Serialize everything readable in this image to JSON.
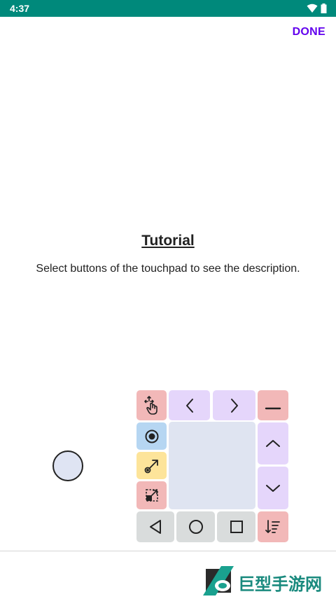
{
  "status_bar": {
    "time": "4:37"
  },
  "header": {
    "done_label": "DONE"
  },
  "tutorial": {
    "title": "Tutorial",
    "description": "Select buttons of the touchpad to see the description."
  },
  "touchpad": {
    "buttons": [
      {
        "name": "move-button",
        "icon": "move-hand-icon",
        "color": "#f2b8b8"
      },
      {
        "name": "left-arrow-button",
        "icon": "chevron-left-icon",
        "color": "#e5d6fb"
      },
      {
        "name": "right-arrow-button",
        "icon": "chevron-right-icon",
        "color": "#e5d6fb"
      },
      {
        "name": "minimize-button",
        "icon": "minus-icon",
        "color": "#f2b8b8"
      },
      {
        "name": "click-button",
        "icon": "radio-dot-icon",
        "color": "#b6d6f2"
      },
      {
        "name": "up-button",
        "icon": "chevron-up-icon",
        "color": "#e5d6fb"
      },
      {
        "name": "drag-button",
        "icon": "drag-arrow-icon",
        "color": "#fde49a"
      },
      {
        "name": "down-button",
        "icon": "chevron-down-icon",
        "color": "#e5d6fb"
      },
      {
        "name": "resize-button",
        "icon": "resize-icon",
        "color": "#f2b8b8"
      },
      {
        "name": "back-button",
        "icon": "triangle-back-icon",
        "color": "#d9dcdc"
      },
      {
        "name": "home-button",
        "icon": "circle-home-icon",
        "color": "#d9dcdc"
      },
      {
        "name": "recents-button",
        "icon": "square-recents-icon",
        "color": "#d9dcdc"
      },
      {
        "name": "sort-button",
        "icon": "sort-down-icon",
        "color": "#f2b8b8"
      }
    ]
  },
  "watermark": {
    "text": "巨型手游网"
  }
}
